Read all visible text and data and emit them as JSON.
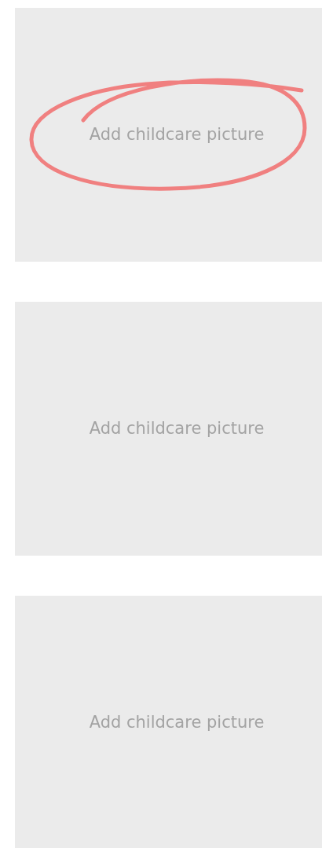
{
  "tiles": [
    {
      "label": "Add childcare picture",
      "highlighted": true
    },
    {
      "label": "Add childcare picture",
      "highlighted": false
    },
    {
      "label": "Add childcare picture",
      "highlighted": false
    }
  ]
}
